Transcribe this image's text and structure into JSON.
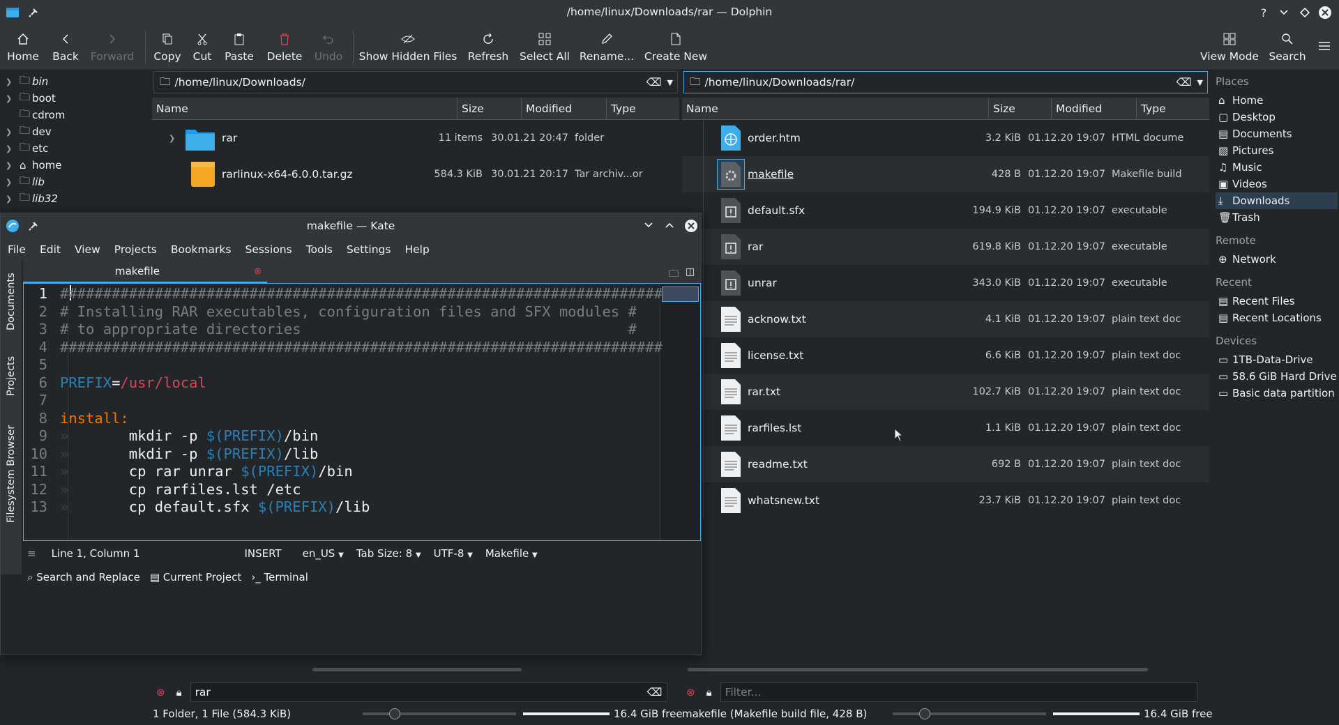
{
  "dolphin": {
    "title": "/home/linux/Downloads/rar — Dolphin",
    "toolbar": {
      "home": "Home",
      "back": "Back",
      "forward": "Forward",
      "copy": "Copy",
      "cut": "Cut",
      "paste": "Paste",
      "delete": "Delete",
      "undo": "Undo",
      "show_hidden": "Show Hidden Files",
      "refresh": "Refresh",
      "select_all": "Select All",
      "rename": "Rename...",
      "create_new": "Create New",
      "view_mode": "View Mode",
      "search": "Search"
    },
    "tree": [
      "bin",
      "boot",
      "cdrom",
      "dev",
      "etc",
      "home",
      "lib",
      "lib32"
    ],
    "left_pane": {
      "path": "/home/linux/Downloads/",
      "columns": [
        "Name",
        "Size",
        "Modified",
        "Type"
      ],
      "rows": [
        {
          "name": "rar",
          "size": "11 items",
          "modified": "30.01.21 20:47",
          "type": "folder"
        },
        {
          "name": "rarlinux-x64-6.0.0.tar.gz",
          "size": "584.3 KiB",
          "modified": "30.01.21 20:17",
          "type": "Tar archiv...or"
        }
      ],
      "filter_value": "rar",
      "status": "1 Folder, 1 File (584.3 KiB)",
      "free": "16.4 GiB free"
    },
    "right_pane": {
      "path": "/home/linux/Downloads/rar/",
      "columns": [
        "Name",
        "Size",
        "Modified",
        "Type"
      ],
      "rows": [
        {
          "name": "order.htm",
          "size": "3.2 KiB",
          "modified": "01.12.20 19:07",
          "type": "HTML docume"
        },
        {
          "name": "makefile",
          "size": "428 B",
          "modified": "01.12.20 19:07",
          "type": "Makefile build"
        },
        {
          "name": "default.sfx",
          "size": "194.9 KiB",
          "modified": "01.12.20 19:07",
          "type": "executable"
        },
        {
          "name": "rar",
          "size": "619.8 KiB",
          "modified": "01.12.20 19:07",
          "type": "executable"
        },
        {
          "name": "unrar",
          "size": "343.0 KiB",
          "modified": "01.12.20 19:07",
          "type": "executable"
        },
        {
          "name": "acknow.txt",
          "size": "4.1 KiB",
          "modified": "01.12.20 19:07",
          "type": "plain text doc"
        },
        {
          "name": "license.txt",
          "size": "6.6 KiB",
          "modified": "01.12.20 19:07",
          "type": "plain text doc"
        },
        {
          "name": "rar.txt",
          "size": "102.7 KiB",
          "modified": "01.12.20 19:07",
          "type": "plain text doc"
        },
        {
          "name": "rarfiles.lst",
          "size": "1.1 KiB",
          "modified": "01.12.20 19:07",
          "type": "plain text doc"
        },
        {
          "name": "readme.txt",
          "size": "692 B",
          "modified": "01.12.20 19:07",
          "type": "plain text doc"
        },
        {
          "name": "whatsnew.txt",
          "size": "23.7 KiB",
          "modified": "01.12.20 19:07",
          "type": "plain text doc"
        }
      ],
      "filter_placeholder": "Filter...",
      "status": "makefile (Makefile build file, 428 B)",
      "free": "16.4 GiB free"
    },
    "places": {
      "places_title": "Places",
      "places_items": [
        "Home",
        "Desktop",
        "Documents",
        "Pictures",
        "Music",
        "Videos",
        "Downloads",
        "Trash"
      ],
      "remote_title": "Remote",
      "remote_items": [
        "Network"
      ],
      "recent_title": "Recent",
      "recent_items": [
        "Recent Files",
        "Recent Locations"
      ],
      "devices_title": "Devices",
      "devices_items": [
        "1TB-Data-Drive",
        "58.6 GiB Hard Drive",
        "Basic data partition"
      ]
    }
  },
  "kate": {
    "title": "makefile — Kate",
    "menu": [
      "File",
      "Edit",
      "View",
      "Projects",
      "Bookmarks",
      "Sessions",
      "Tools",
      "Settings",
      "Help"
    ],
    "tab": "makefile",
    "side_tabs": [
      "Documents",
      "Projects",
      "Filesystem Browser"
    ],
    "lines": [
      {
        "n": "1",
        "segs": [
          [
            "c-comment",
            "######################################################################"
          ]
        ]
      },
      {
        "n": "2",
        "segs": [
          [
            "c-comment",
            "# Installing RAR executables, configuration files and SFX modules #"
          ]
        ]
      },
      {
        "n": "3",
        "segs": [
          [
            "c-comment",
            "# to appropriate directories                                      #"
          ]
        ]
      },
      {
        "n": "4",
        "segs": [
          [
            "c-comment",
            "######################################################################"
          ]
        ]
      },
      {
        "n": "5",
        "segs": []
      },
      {
        "n": "6",
        "segs": [
          [
            "c-var",
            "PREFIX"
          ],
          [
            "c-text",
            "="
          ],
          [
            "c-val",
            "/usr/local"
          ]
        ]
      },
      {
        "n": "7",
        "segs": []
      },
      {
        "n": "8",
        "segs": [
          [
            "c-target",
            "install:"
          ]
        ]
      },
      {
        "n": "9",
        "segs": [
          [
            "c-tab",
            "»       "
          ],
          [
            "c-text",
            "mkdir -p "
          ],
          [
            "c-var",
            "$(PREFIX)"
          ],
          [
            "c-text",
            "/bin"
          ]
        ]
      },
      {
        "n": "10",
        "segs": [
          [
            "c-tab",
            "»       "
          ],
          [
            "c-text",
            "mkdir -p "
          ],
          [
            "c-var",
            "$(PREFIX)"
          ],
          [
            "c-text",
            "/lib"
          ]
        ]
      },
      {
        "n": "11",
        "segs": [
          [
            "c-tab",
            "»       "
          ],
          [
            "c-text",
            "cp rar unrar "
          ],
          [
            "c-var",
            "$(PREFIX)"
          ],
          [
            "c-text",
            "/bin"
          ]
        ]
      },
      {
        "n": "12",
        "segs": [
          [
            "c-tab",
            "»       "
          ],
          [
            "c-text",
            "cp rarfiles.lst /etc"
          ]
        ]
      },
      {
        "n": "13",
        "segs": [
          [
            "c-tab",
            "»       "
          ],
          [
            "c-text",
            "cp default.sfx "
          ],
          [
            "c-var",
            "$(PREFIX)"
          ],
          [
            "c-text",
            "/lib"
          ]
        ]
      }
    ],
    "status": {
      "cursor": "Line 1, Column 1",
      "mode": "INSERT",
      "lang": "en_US",
      "tab_size": "Tab Size: 8",
      "encoding": "UTF-8",
      "syntax": "Makefile"
    },
    "bottom_tools": [
      "Search and Replace",
      "Current Project",
      "Terminal"
    ]
  },
  "colors": {
    "accent": "#3daee9",
    "bg": "#232629",
    "panel": "#31363b"
  }
}
